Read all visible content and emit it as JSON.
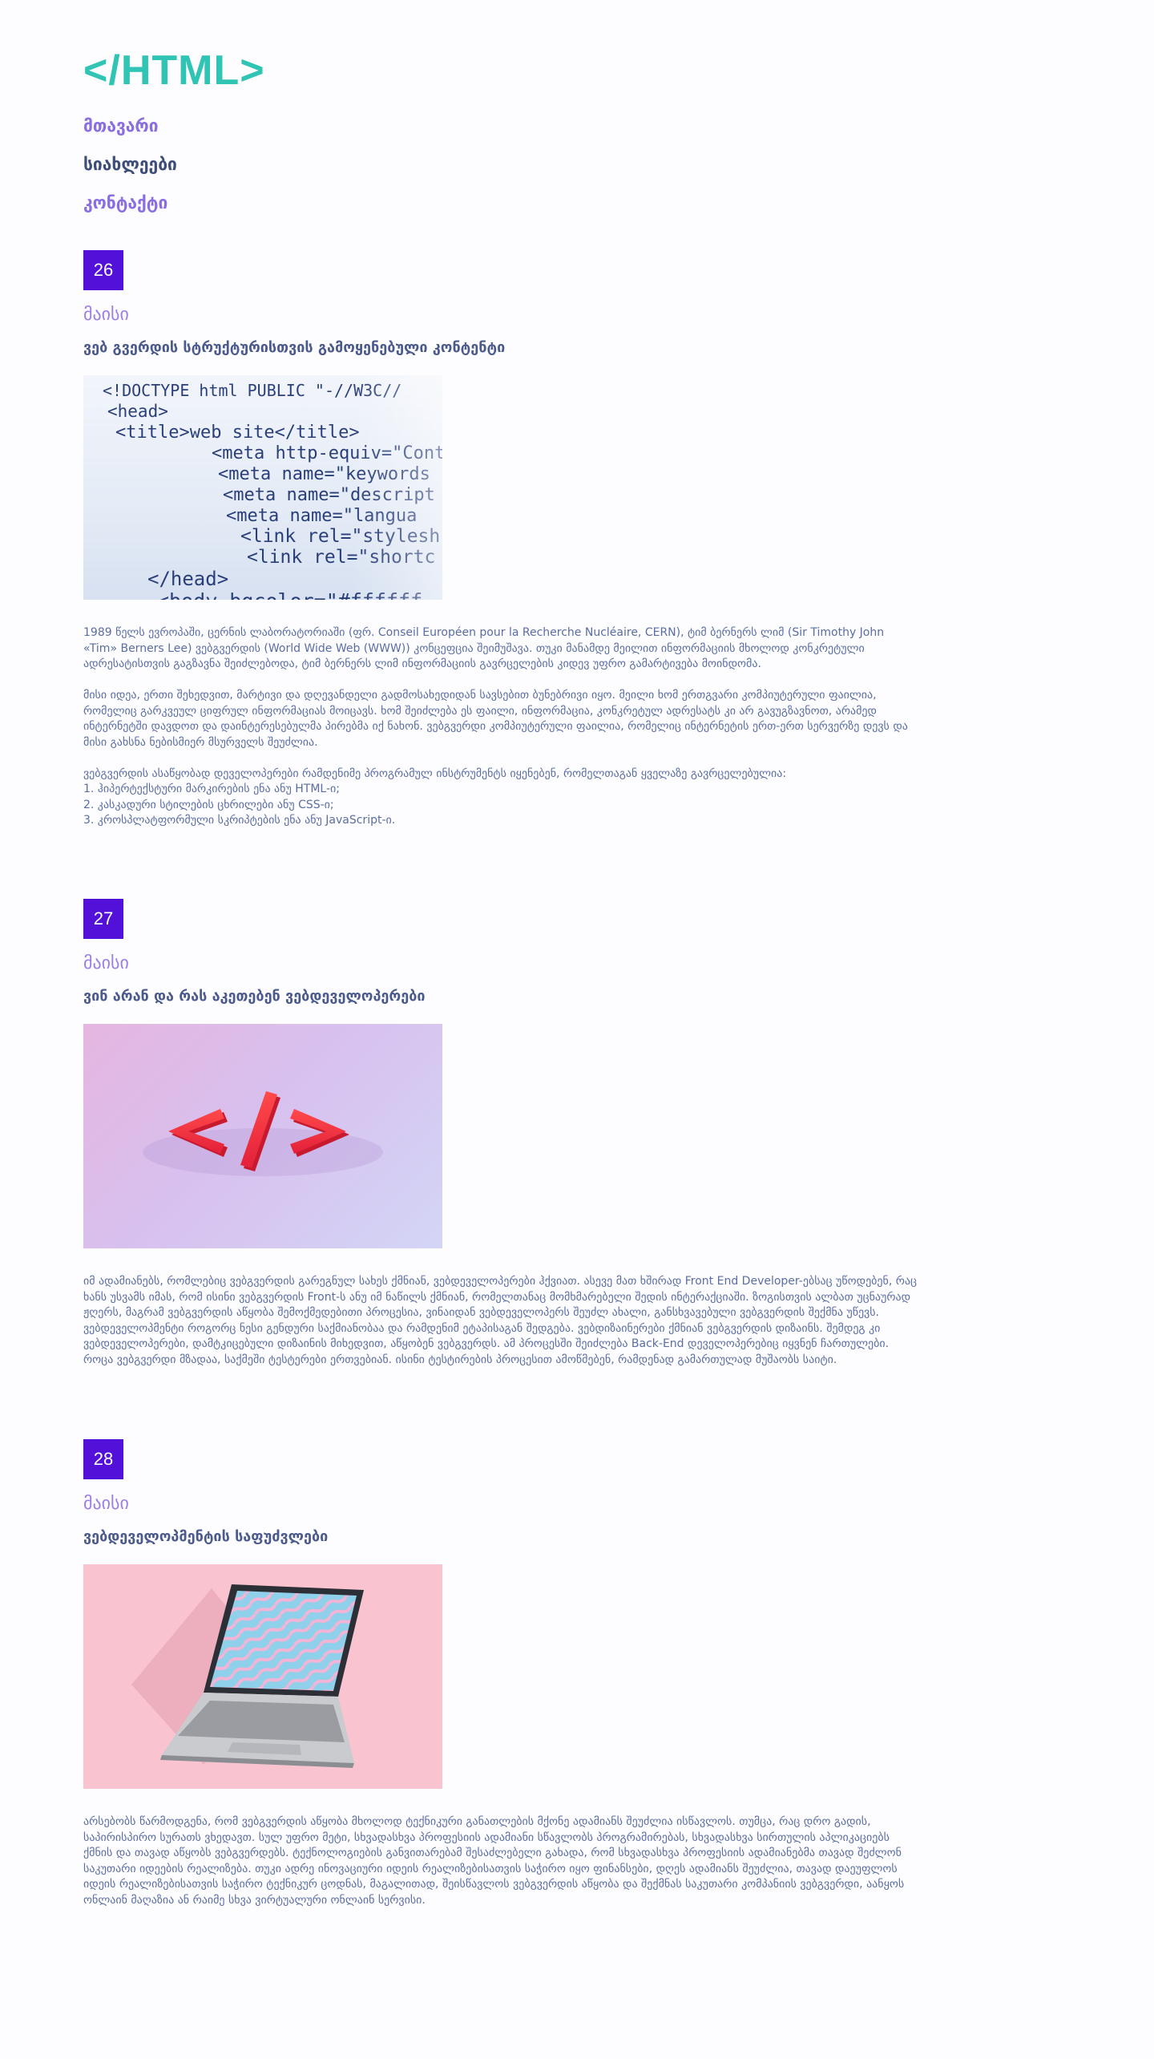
{
  "site": {
    "logo": "</HTML>"
  },
  "nav": {
    "items": [
      {
        "label": "მთავარი"
      },
      {
        "label": "სიახლეები"
      },
      {
        "label": "კონტაქტი"
      }
    ]
  },
  "posts": [
    {
      "day": "26",
      "month": "მაისი",
      "title": "ვებ გვერდის სტრუქტურისთვის გამოყენებული კონტენტი",
      "image": "html-code-photo",
      "text": "1989 წელს ევროპაში, ცერნის ლაბორატორიაში (ფრ. Conseil Européen pour la Recherche Nucléaire, CERN), ტიმ ბერნერს ლიმ (Sir Timothy John «Tim» Berners Lee) ვებგვერდის (World Wide Web (WWW)) კონცეფცია შეიმუშავა. თუკი მანამდე მეილით ინფორმაციის მხოლოდ კონკრეტული ადრესატისთვის გაგზავნა შეიძლებოდა, ტიმ ბერნერს ლიმ ინფორმაციის გავრცელების კიდევ უფრო გამარტივება მოინდომა.\n\nმისი იდეა, ერთი შეხედვით, მარტივი და დღევანდელი გადმოსახედიდან სავსებით ბუნებრივი იყო. მეილი ხომ ერთგვარი კომპიუტერული ფაილია, რომელიც გარკვეულ ციფრულ ინფორმაციას მოიცავს. ხომ შეიძლება ეს ფაილი, ინფორმაცია, კონკრეტულ ადრესატს კი არ გავუგზავნოთ, არამედ ინტერნეტში დავდოთ და დაინტერესებულმა პირებმა იქ ნახონ. ვებგვერდი კომპიუტერული ფაილია, რომელიც ინტერნეტის ერთ-ერთ სერვერზე დევს და მისი გახსნა ნებისმიერ მსურველს შეუძლია.\n\nვებგვერდის ასაწყობად დეველოპერები რამდენიმე პროგრამულ ინსტრუმენტს იყენებენ, რომელთაგან ყველაზე გავრცელებულია:\n1. ჰიპერტექსტური მარკირების ენა ანუ HTML-ი;\n2. კასკადური სტილების ცხრილები ანუ CSS-ი;\n3. კროსპლატფორმული სკრიპტების ენა ანუ JavaScript-ი."
    },
    {
      "day": "27",
      "month": "მაისი",
      "title": "ვინ არან და რას აკეთებენ ვებდეველოპერები",
      "image": "code-sign-photo",
      "text": "იმ ადამიანებს, რომლებიც ვებგვერდის გარეგნულ სახეს ქმნიან, ვებდეველოპერები ჰქვიათ. ასევე მათ ხშირად Front End Developer-ებსაც უწოდებენ, რაც ხანს უსვამს იმას, რომ ისინი ვებგვერდის Front-ს ანუ იმ ნაწილს ქმნიან, რომელთანაც მომხმარებელი შედის ინტერაქციაში. ზოგისთვის ალბათ უცნაურად ჟღერს, მაგრამ ვებგვერდის აწყობა შემოქმედებითი პროცესია, ვინაიდან ვებდეველოპერს შეუძლ ახალი, განსხვავებული ვებგვერდის შექმნა უწევს. ვებდეველოპმენტი როგორც ნესი გენდური საქმიანობაა და რამდენიმ ეტაპისაგან შედგება. ვებდიზაინერები ქმნიან ვებგვერდის დიზაინს. შემდეგ კი ვებდეველოპერები, დამტკიცებული დიზაინის მიხედვით, აწყობენ ვებგვერდს. ამ პროცესში შეიძლება Back-End დეველოპერებიც იყვნენ ჩართულები. როცა ვებგვერდი მზადაა, საქმეში ტესტერები ერთვებიან. ისინი ტესტირების პროცესით ამოწმებენ, რამდენად გამართულად მუშაობს საიტი."
    },
    {
      "day": "28",
      "month": "მაისი",
      "title": "ვებდეველოპმენტის საფუძვლები",
      "image": "laptop-photo",
      "text": "არსებობს წარმოდგენა, რომ ვებგვერდის აწყობა მხოლოდ ტექნიკური განათლების მქონე ადამიანს შეუძლია ისწავლოს. თუმცა, რაც დრო გადის, საპირისპირო სურათს ვხედავთ. სულ უფრო მეტი, სხვადასხვა პროფესიის ადამიანი სწავლობს პროგრამირებას, სხვადასხვა სირთულის აპლიკაციებს ქმნის და თავად აწყობს ვებგვერდებს. ტექნოლოგიების განვითარებამ შესაძლებელი გახადა, რომ სხვადასხვა პროფესიის ადამიანებმა თავად შეძლონ საკუთარი იდეების რეალიზება. თუკი ადრე ინოვაციური იდეის რეალიზებისათვის საჭირო იყო ფინანსები, დღეს ადამიანს შეუძლია, თავად დაეუფლოს იდეის რეალიზებისათვის საჭირო ტექნიკურ ცოდნას, მაგალითად, შეისწავლოს ვებგვერდის აწყობა და შექმნას საკუთარი კომპანიის ვებგვერდი, აანყოს ონლაინ მაღაზია ან რაიმე სხვა ვირტუალური ონლაინ სერვისი."
    }
  ],
  "code_image": {
    "lines": [
      "<!DOCTYPE html PUBLIC \"-//W3C//",
      "<head>",
      "<title>web site</title>",
      "<meta http-equiv=\"Conte",
      "<meta name=\"keywords",
      "<meta name=\"descript",
      "<meta name=\"langua",
      "<link rel=\"stylesh",
      "<link rel=\"shortc",
      "</head>",
      "<body bgcolor=\"#ffffff"
    ]
  },
  "colors": {
    "logo": "#2fc4b3",
    "nav_link": "#8a6de0",
    "nav_active": "#3d4d79",
    "date_badge": "#5310d8",
    "month": "#9b7ee8",
    "text": "#5a6ea4"
  }
}
